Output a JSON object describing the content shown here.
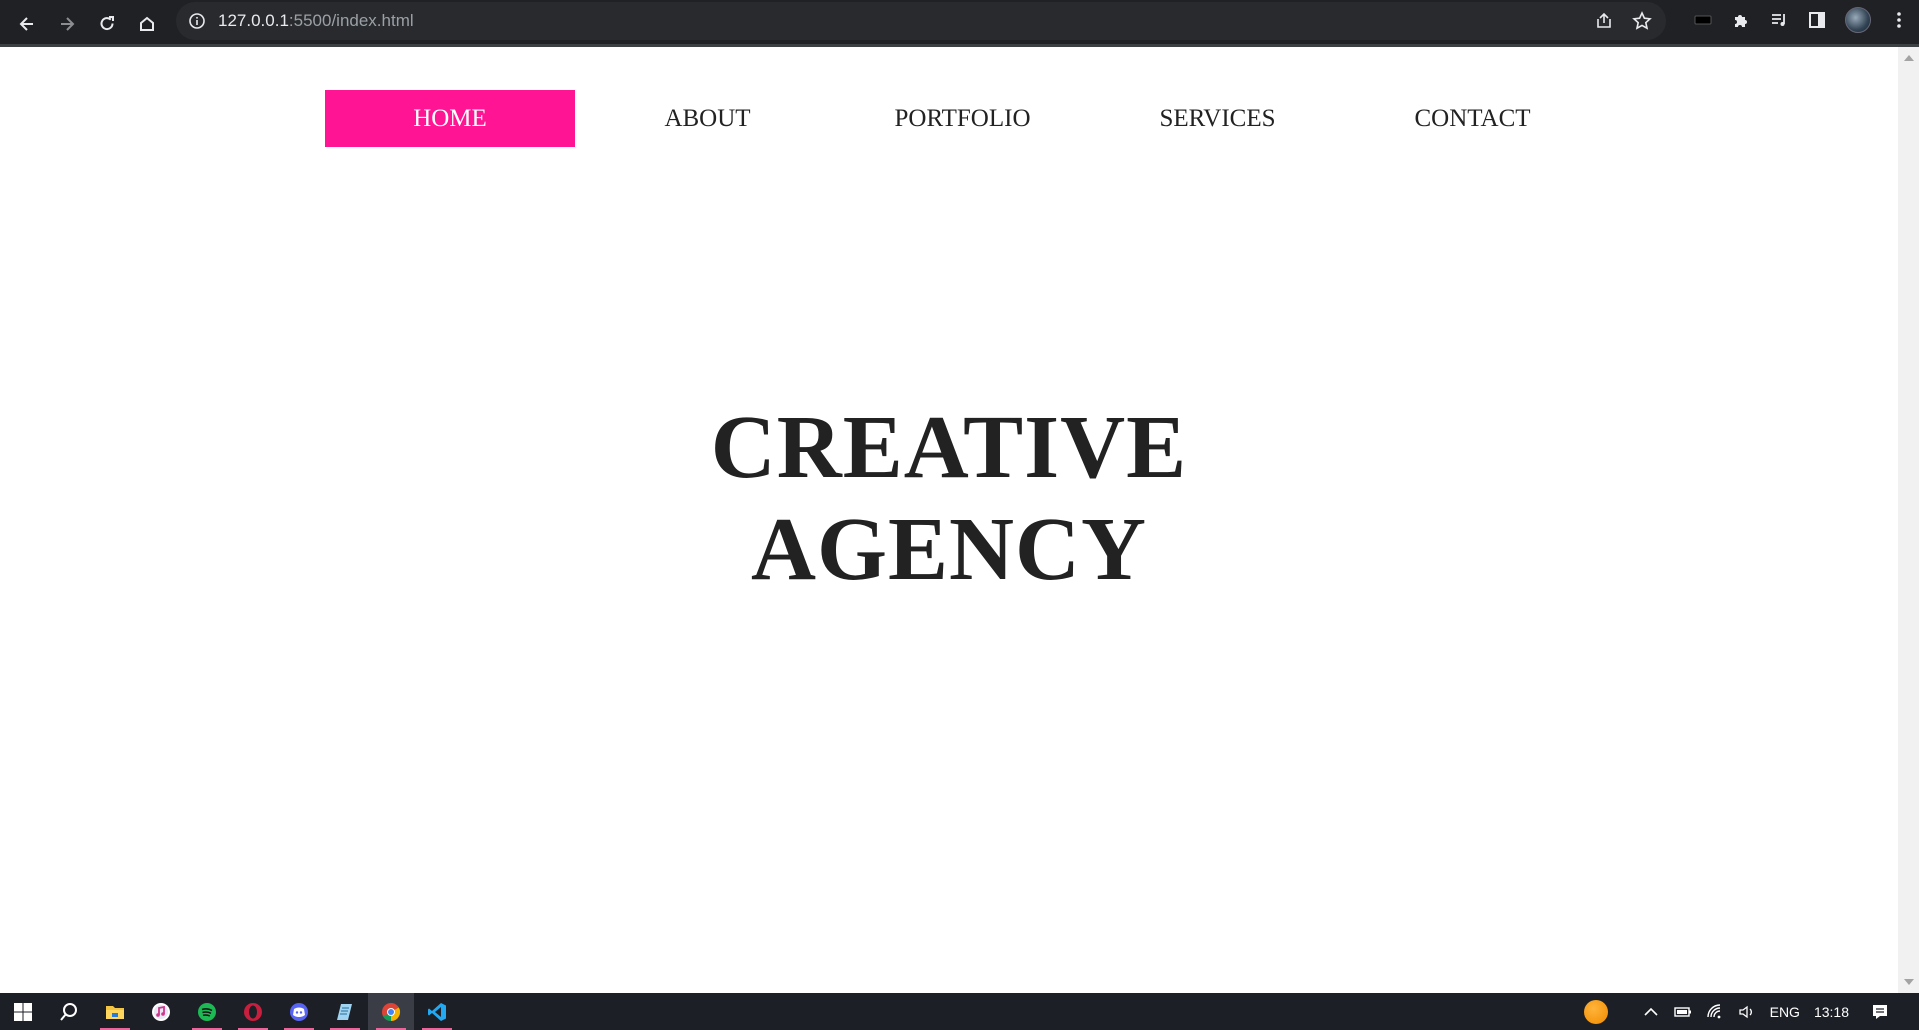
{
  "browser": {
    "url_host": "127.0.0.1",
    "url_path": ":5500/index.html"
  },
  "nav": {
    "items": [
      {
        "label": "HOME",
        "active": true
      },
      {
        "label": "ABOUT",
        "active": false
      },
      {
        "label": "PORTFOLIO",
        "active": false
      },
      {
        "label": "SERVICES",
        "active": false
      },
      {
        "label": "CONTACT",
        "active": false
      }
    ]
  },
  "hero": {
    "line1": "CREATIVE",
    "line2": "AGENCY"
  },
  "colors": {
    "accent": "#ff1493",
    "text": "#222222",
    "browser_bar": "#202124",
    "taskbar": "#1c1f26"
  },
  "taskbar": {
    "apps": [
      "start-icon",
      "search-icon",
      "file-explorer-icon",
      "itunes-icon",
      "spotify-icon",
      "opera-icon",
      "discord-icon",
      "notepad-icon",
      "chrome-icon",
      "vscode-icon"
    ],
    "language": "ENG",
    "time": "13:18"
  }
}
